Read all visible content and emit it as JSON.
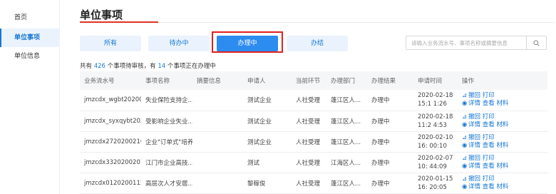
{
  "sidebar": {
    "items": [
      {
        "label": "首页"
      },
      {
        "label": "单位事项"
      },
      {
        "label": "单位信息"
      }
    ]
  },
  "page": {
    "title": "单位事项"
  },
  "tabs": [
    {
      "label": "所有"
    },
    {
      "label": "待办中"
    },
    {
      "label": "办理中"
    },
    {
      "label": "办结"
    }
  ],
  "search": {
    "placeholder": "请输入业务流水号、事项名称或摘要信息"
  },
  "summary": {
    "prefix": "共有",
    "total": "426",
    "middle": "个事项待审核，有",
    "in_progress": "14",
    "suffix": "个事项正在办理中"
  },
  "table": {
    "headers": [
      "业务流水号",
      "事项名称",
      "摘要信息",
      "申请人",
      "当前环节",
      "办理部门",
      "办理结果",
      "申请时间",
      "操作"
    ],
    "rows": [
      {
        "id": "jmzcdx_wgbt20200...",
        "name": "失业保险支持企...",
        "summary": "",
        "applicant": "测试企业",
        "stage": "人社受理",
        "dept": "蓬江区人...",
        "result": "办理中",
        "time": "2020-02-18 15:1 1:26"
      },
      {
        "id": "jmzcdx_syxqybt202...",
        "name": "受影响企业失业...",
        "summary": "",
        "applicant": "测试企业",
        "stage": "人社受理",
        "dept": "蓬江区人...",
        "result": "办理中",
        "time": "2020-02-18 11:2 4:53"
      },
      {
        "id": "jmzcdx2720200210...",
        "name": "企业\"订单式\"培养...",
        "summary": "",
        "applicant": "测试企业",
        "stage": "人社受理",
        "dept": "蓬江区人...",
        "result": "办理中",
        "time": "2020-02-10 16: 00:10"
      },
      {
        "id": "jmzcdx3320200207...",
        "name": "江门市企业高技...",
        "summary": "",
        "applicant": "测试",
        "stage": "人社受理",
        "dept": "江海区人...",
        "result": "办理中",
        "time": "2020-02-07 10: 44:09"
      },
      {
        "id": "jmzcdx0120200115...",
        "name": "高层次人才安居...",
        "summary": "",
        "applicant": "黎稼俊",
        "stage": "人社受理",
        "dept": "蓬江区人...",
        "result": "办理中",
        "time": "2020-01-15 16: 20:05"
      }
    ],
    "ops": {
      "withdraw": "撤回",
      "print": "打印",
      "detail": "详情",
      "view": "查看",
      "material": "材料"
    }
  },
  "colors": {
    "accent": "#1677d4",
    "active_tab": "#2d8cf0",
    "highlight": "#e02020",
    "title_accent": "#dd3322"
  }
}
